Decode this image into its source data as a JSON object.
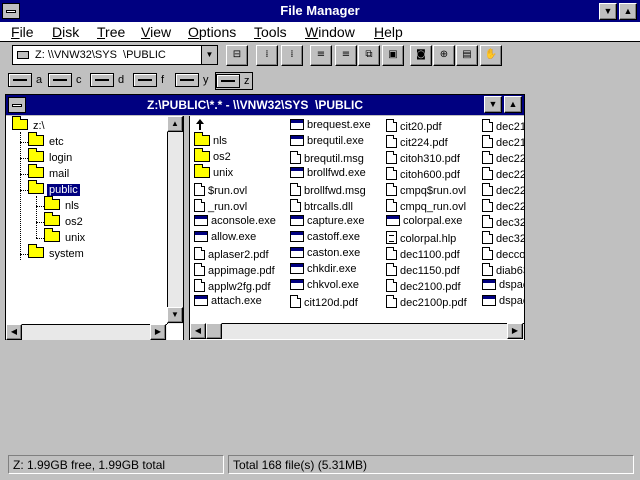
{
  "window": {
    "title": "File Manager"
  },
  "menu": [
    "File",
    "Disk",
    "Tree",
    "View",
    "Options",
    "Tools",
    "Window",
    "Help"
  ],
  "toolbar": {
    "drive_select": "Z: \\\\VNW32\\SYS  \\PUBLIC",
    "buttons": [
      "connect-net-icon",
      "disconnect-net-icon",
      "large-icons-icon",
      "sort-name-icon",
      "sort-type-icon",
      "sort-size-icon",
      "sort-date-icon",
      "copy-icon",
      "move-icon",
      "delete-icon",
      "properties-icon",
      "disk-icon",
      "new-folder-icon",
      "network-icon",
      "share-icon"
    ]
  },
  "drives": [
    {
      "letter": "a",
      "selected": false
    },
    {
      "letter": "c",
      "selected": false
    },
    {
      "letter": "d",
      "selected": false
    },
    {
      "letter": "f",
      "selected": false
    },
    {
      "letter": "y",
      "selected": false
    },
    {
      "letter": "z",
      "selected": true
    }
  ],
  "child_window": {
    "title": "Z:\\PUBLIC\\*.* - \\\\VNW32\\SYS  \\PUBLIC"
  },
  "tree": [
    {
      "name": "z:\\",
      "level": 0,
      "selected": false
    },
    {
      "name": "etc",
      "level": 1,
      "selected": false
    },
    {
      "name": "login",
      "level": 1,
      "selected": false
    },
    {
      "name": "mail",
      "level": 1,
      "selected": false
    },
    {
      "name": "public",
      "level": 1,
      "selected": true
    },
    {
      "name": "nls",
      "level": 2,
      "selected": false
    },
    {
      "name": "os2",
      "level": 2,
      "selected": false
    },
    {
      "name": "unix",
      "level": 2,
      "selected": false
    },
    {
      "name": "system",
      "level": 1,
      "selected": false
    }
  ],
  "files": [
    [
      {
        "name": "",
        "icon": "up"
      },
      {
        "name": "nls",
        "icon": "folder"
      },
      {
        "name": "os2",
        "icon": "folder"
      },
      {
        "name": "unix",
        "icon": "folder"
      },
      {
        "name": "$run.ovl",
        "icon": "doc"
      },
      {
        "name": "_run.ovl",
        "icon": "doc"
      },
      {
        "name": "aconsole.exe",
        "icon": "exe"
      },
      {
        "name": "allow.exe",
        "icon": "exe"
      },
      {
        "name": "aplaser2.pdf",
        "icon": "doc"
      },
      {
        "name": "appimage.pdf",
        "icon": "doc"
      },
      {
        "name": "applw2fg.pdf",
        "icon": "doc"
      },
      {
        "name": "attach.exe",
        "icon": "exe"
      }
    ],
    [
      {
        "name": "brequest.exe",
        "icon": "exe"
      },
      {
        "name": "brequtil.exe",
        "icon": "exe"
      },
      {
        "name": "brequtil.msg",
        "icon": "doc"
      },
      {
        "name": "brollfwd.exe",
        "icon": "exe"
      },
      {
        "name": "brollfwd.msg",
        "icon": "doc"
      },
      {
        "name": "btrcalls.dll",
        "icon": "doc"
      },
      {
        "name": "capture.exe",
        "icon": "exe"
      },
      {
        "name": "castoff.exe",
        "icon": "exe"
      },
      {
        "name": "caston.exe",
        "icon": "exe"
      },
      {
        "name": "chkdir.exe",
        "icon": "exe"
      },
      {
        "name": "chkvol.exe",
        "icon": "exe"
      },
      {
        "name": "cit120d.pdf",
        "icon": "doc"
      }
    ],
    [
      {
        "name": "cit20.pdf",
        "icon": "doc"
      },
      {
        "name": "cit224.pdf",
        "icon": "doc"
      },
      {
        "name": "citoh310.pdf",
        "icon": "doc"
      },
      {
        "name": "citoh600.pdf",
        "icon": "doc"
      },
      {
        "name": "cmpq$run.ovl",
        "icon": "doc"
      },
      {
        "name": "cmpq_run.ovl",
        "icon": "doc"
      },
      {
        "name": "colorpal.exe",
        "icon": "exe"
      },
      {
        "name": "colorpal.hlp",
        "icon": "assoc"
      },
      {
        "name": "dec1100.pdf",
        "icon": "doc"
      },
      {
        "name": "dec1150.pdf",
        "icon": "doc"
      },
      {
        "name": "dec2100.pdf",
        "icon": "doc"
      },
      {
        "name": "dec2100p.pdf",
        "icon": "doc"
      }
    ],
    [
      {
        "name": "dec21",
        "icon": "doc"
      },
      {
        "name": "dec21",
        "icon": "doc"
      },
      {
        "name": "dec22",
        "icon": "doc"
      },
      {
        "name": "dec22",
        "icon": "doc"
      },
      {
        "name": "dec22",
        "icon": "doc"
      },
      {
        "name": "dec22",
        "icon": "doc"
      },
      {
        "name": "dec32",
        "icon": "doc"
      },
      {
        "name": "dec32",
        "icon": "doc"
      },
      {
        "name": "decco",
        "icon": "doc"
      },
      {
        "name": "diab63",
        "icon": "doc"
      },
      {
        "name": "dspace",
        "icon": "exe"
      },
      {
        "name": "dspace",
        "icon": "exe"
      }
    ]
  ],
  "status": {
    "free": "Z: 1.99GB free,  1.99GB total",
    "total": "Total 168 file(s) (5.31MB)"
  }
}
